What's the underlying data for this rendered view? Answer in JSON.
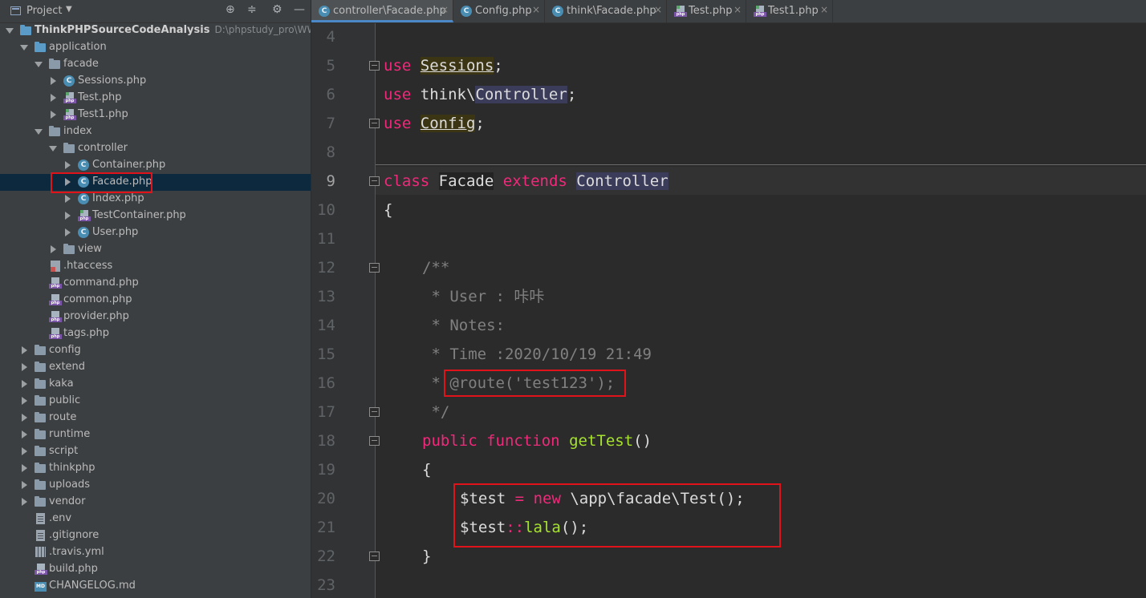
{
  "sidebar": {
    "header": {
      "title": "Project"
    },
    "tree": [
      {
        "label": "ThinkPHPSourceCodeAnalysis",
        "hint": "D:\\phpstudy_pro\\WWW\\Th"
      },
      {
        "label": "application"
      },
      {
        "label": "facade"
      },
      {
        "label": "Sessions.php"
      },
      {
        "label": "Test.php"
      },
      {
        "label": "Test1.php"
      },
      {
        "label": "index"
      },
      {
        "label": "controller"
      },
      {
        "label": "Container.php"
      },
      {
        "label": "Facade.php"
      },
      {
        "label": "Index.php"
      },
      {
        "label": "TestContainer.php"
      },
      {
        "label": "User.php"
      },
      {
        "label": "view"
      },
      {
        "label": ".htaccess"
      },
      {
        "label": "command.php"
      },
      {
        "label": "common.php"
      },
      {
        "label": "provider.php"
      },
      {
        "label": "tags.php"
      },
      {
        "label": "config"
      },
      {
        "label": "extend"
      },
      {
        "label": "kaka"
      },
      {
        "label": "public"
      },
      {
        "label": "route"
      },
      {
        "label": "runtime"
      },
      {
        "label": "script"
      },
      {
        "label": "thinkphp"
      },
      {
        "label": "uploads"
      },
      {
        "label": "vendor"
      },
      {
        "label": ".env"
      },
      {
        "label": ".gitignore"
      },
      {
        "label": ".travis.yml"
      },
      {
        "label": "build.php"
      },
      {
        "label": "CHANGELOG.md"
      }
    ]
  },
  "tabs": [
    {
      "label": "controller\\Facade.php",
      "close": "×"
    },
    {
      "label": "Config.php",
      "close": "×"
    },
    {
      "label": "think\\Facade.php",
      "close": "×"
    },
    {
      "label": "Test.php",
      "close": "×"
    },
    {
      "label": "Test1.php",
      "close": "×"
    }
  ],
  "editor": {
    "line_numbers": [
      "4",
      "5",
      "6",
      "7",
      "8",
      "9",
      "10",
      "11",
      "12",
      "13",
      "14",
      "15",
      "16",
      "17",
      "18",
      "19",
      "20",
      "21",
      "22",
      "23"
    ],
    "current_line": "9",
    "code": {
      "l5": {
        "kw": "use",
        "name": "Sessions",
        "end": ";"
      },
      "l6": {
        "kw": "use",
        "ns": "think\\",
        "name": "Controller",
        "end": ";"
      },
      "l7": {
        "kw": "use",
        "name": "Config",
        "end": ";"
      },
      "l9": {
        "kw1": "class",
        "name": "Facade",
        "kw2": "extends",
        "parent": "Controller"
      },
      "l10": "{",
      "l12": "/**",
      "l13": " * User : 咔咔",
      "l14": " * Notes:",
      "l15": " * Time :2020/10/19 21:49",
      "l16": {
        "prefix": " * ",
        "annotation": "@route('test123');"
      },
      "l17": " */",
      "l18": {
        "kw1": "public",
        "kw2": "function",
        "fn": "getTest",
        "end": "()"
      },
      "l19": "{",
      "l20": {
        "var": "$test",
        "op": "=",
        "kw": "new",
        "cls": "\\app\\facade\\Test",
        "end": "();"
      },
      "l21": {
        "var": "$test",
        "op": "::",
        "fn": "lala",
        "end": "();"
      },
      "l22": "}"
    }
  }
}
